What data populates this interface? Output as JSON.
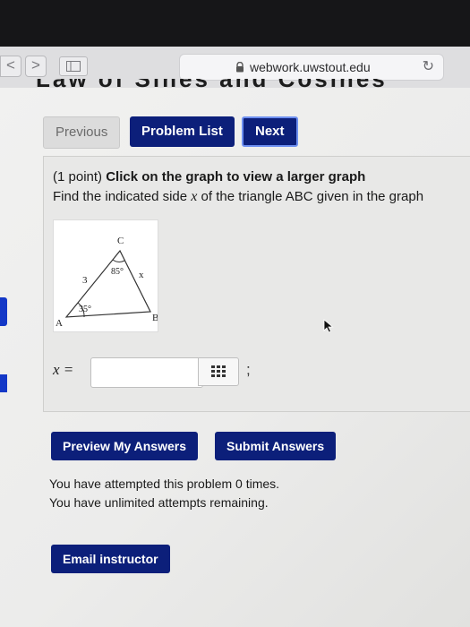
{
  "browser": {
    "url": "webwork.uwstout.edu",
    "back_glyph": "<",
    "forward_glyph": ">",
    "reload_glyph": "↻"
  },
  "page": {
    "cut_title": "Law of Sines and Cosines"
  },
  "nav_buttons": {
    "previous": "Previous",
    "problem_list": "Problem List",
    "next": "Next"
  },
  "problem": {
    "points": "(1 point)",
    "instruction_bold": "Click on the graph to view a larger graph",
    "task_before": "Find the indicated side ",
    "task_var": "x",
    "task_after": " of the triangle ABC given in the graph",
    "graph": {
      "vertex_a": "A",
      "vertex_b": "B",
      "vertex_c": "C",
      "angle_c": "85°",
      "angle_a": "35°",
      "side_ac": "3",
      "side_cb": "x"
    },
    "answer_label": "x =",
    "answer_value": "",
    "separator": ";"
  },
  "actions": {
    "preview": "Preview My Answers",
    "submit": "Submit Answers",
    "email": "Email instructor"
  },
  "status": {
    "attempted": "You have attempted this problem 0 times.",
    "remaining": "You have unlimited attempts remaining."
  },
  "colors": {
    "button_blue": "#0c1f7a",
    "next_border": "#6d8ff0",
    "side_tab_blue": "#1338c7"
  }
}
